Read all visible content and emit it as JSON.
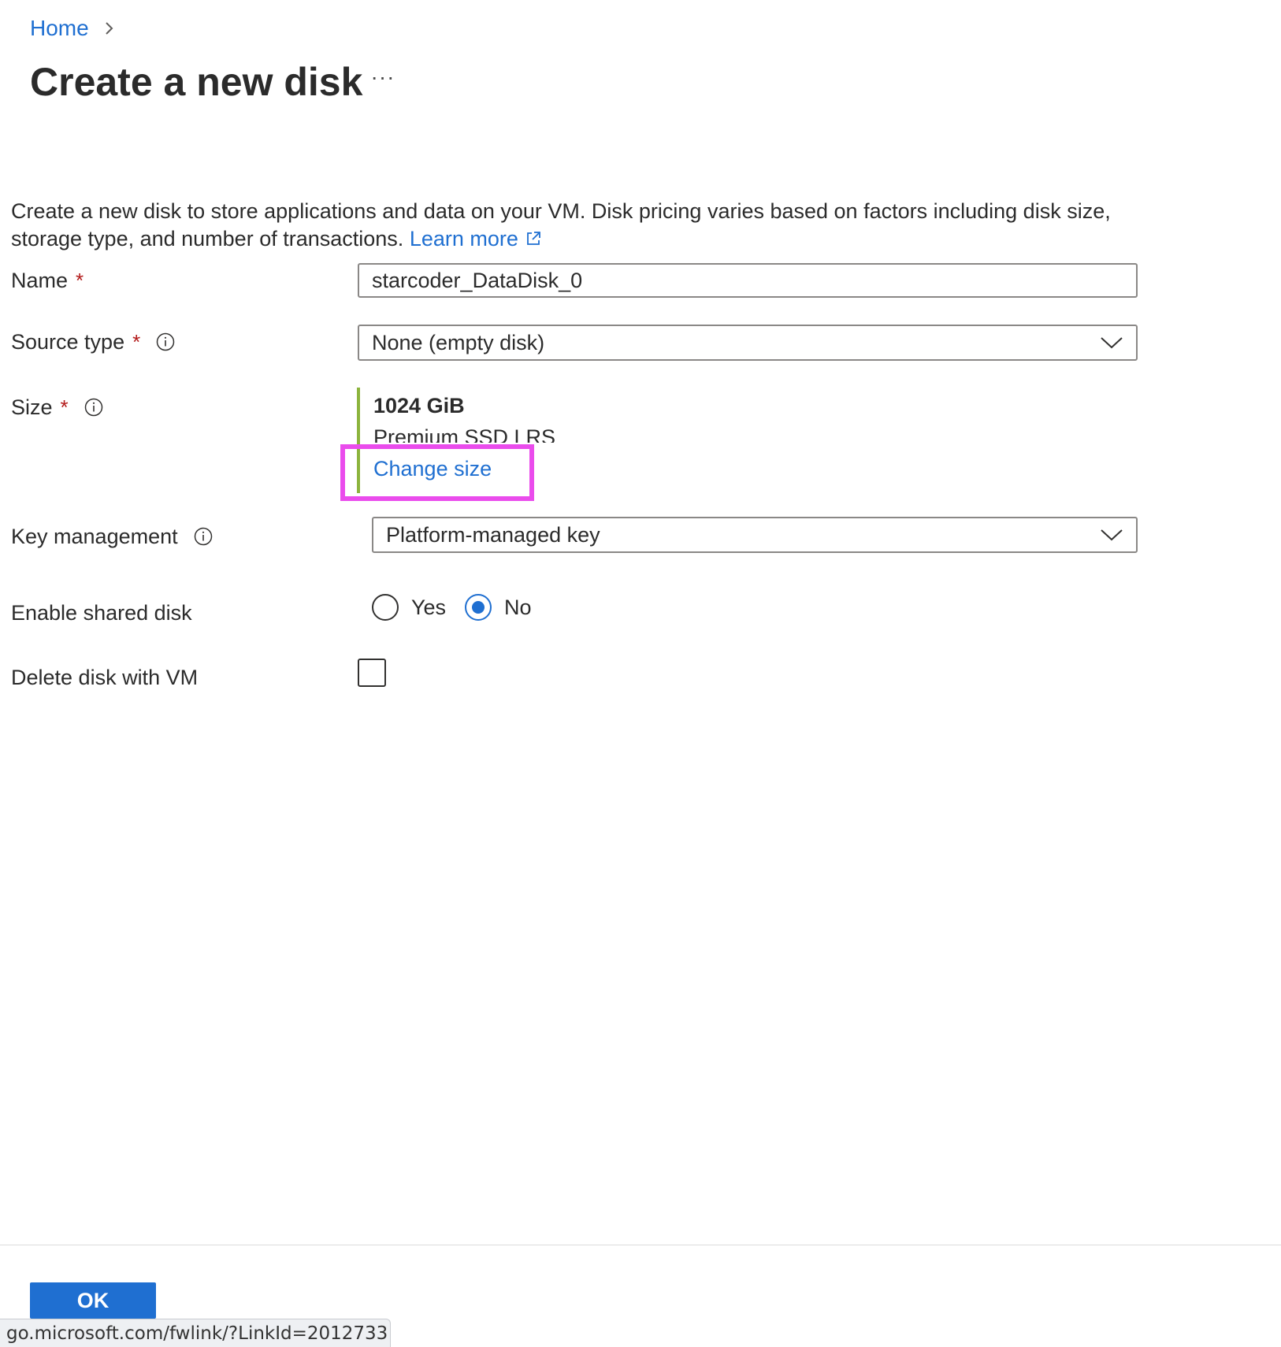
{
  "breadcrumb": {
    "home_label": "Home"
  },
  "page": {
    "title": "Create a new disk",
    "more_label": "···"
  },
  "description": {
    "text": "Create a new disk to store applications and data on your VM. Disk pricing varies based on factors including disk size, storage type, and number of transactions.",
    "learn_more_label": "Learn more"
  },
  "form": {
    "name": {
      "label": "Name",
      "required_mark": "*",
      "value": "starcoder_DataDisk_0"
    },
    "source_type": {
      "label": "Source type",
      "required_mark": "*",
      "selected": "None (empty disk)"
    },
    "size": {
      "label": "Size",
      "required_mark": "*",
      "value": "1024 GiB",
      "sku": "Premium SSD LRS",
      "change_label": "Change size"
    },
    "key_management": {
      "label": "Key management",
      "selected": "Platform-managed key"
    },
    "shared_disk": {
      "label": "Enable shared disk",
      "options": [
        "Yes",
        "No"
      ],
      "selected": "No"
    },
    "delete_with_vm": {
      "label": "Delete disk with VM",
      "checked": false
    }
  },
  "footer": {
    "ok_label": "OK"
  },
  "status_bar": {
    "url": "go.microsoft.com/fwlink/?LinkId=2012733"
  },
  "colors": {
    "link": "#1f6fd1",
    "primary_button": "#1f6fd1",
    "size_accent": "#8cb43d",
    "required": "#b31b1b",
    "highlight": "#ea4cec"
  },
  "icons": {
    "breadcrumb_separator": "chevron-right-icon",
    "external_link": "external-link-icon",
    "info": "info-icon",
    "dropdown": "chevron-down-icon"
  }
}
